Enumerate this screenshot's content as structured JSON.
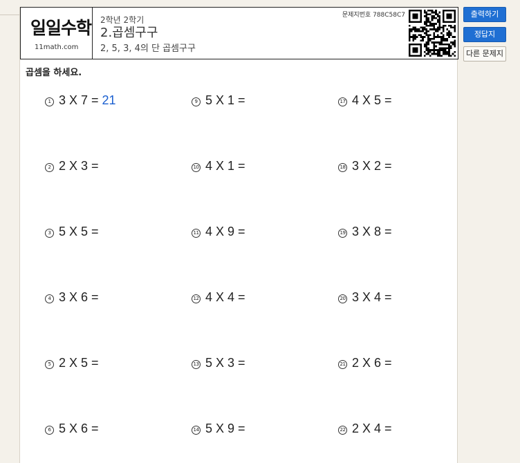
{
  "header": {
    "logo": "일일수학",
    "site": "11math.com",
    "grade": "2학년 2학기",
    "title": "2.곱셈구구",
    "subtitle": "2, 5, 3, 4의 단 곱셈구구",
    "code": "문제지번호 788C58C7"
  },
  "instruction": "곱셈을 하세요.",
  "buttons": {
    "print": "출력하기",
    "answers": "정답지",
    "other": "다른 문제지"
  },
  "colors": {
    "accent": "#1f6fd3",
    "answer": "#1a5fd0"
  },
  "columns": [
    [
      {
        "num": "1",
        "expr": "3 X 7 =",
        "answer": "21"
      },
      {
        "num": "2",
        "expr": "2 X 3 =",
        "answer": ""
      },
      {
        "num": "3",
        "expr": "5 X 5 =",
        "answer": ""
      },
      {
        "num": "4",
        "expr": "3 X 6 =",
        "answer": ""
      },
      {
        "num": "5",
        "expr": "2 X 5 =",
        "answer": ""
      },
      {
        "num": "6",
        "expr": "5 X 6 =",
        "answer": ""
      }
    ],
    [
      {
        "num": "9",
        "expr": "5 X 1 =",
        "answer": ""
      },
      {
        "num": "10",
        "expr": "4 X 1 =",
        "answer": ""
      },
      {
        "num": "11",
        "expr": "4 X 9 =",
        "answer": ""
      },
      {
        "num": "12",
        "expr": "4 X 4 =",
        "answer": ""
      },
      {
        "num": "13",
        "expr": "5 X 3 =",
        "answer": ""
      },
      {
        "num": "14",
        "expr": "5 X 9 =",
        "answer": ""
      }
    ],
    [
      {
        "num": "17",
        "expr": "4 X 5 =",
        "answer": ""
      },
      {
        "num": "18",
        "expr": "3 X 2 =",
        "answer": ""
      },
      {
        "num": "19",
        "expr": "3 X 8 =",
        "answer": ""
      },
      {
        "num": "20",
        "expr": "3 X 4 =",
        "answer": ""
      },
      {
        "num": "21",
        "expr": "2 X 6 =",
        "answer": ""
      },
      {
        "num": "22",
        "expr": "2 X 4 =",
        "answer": ""
      }
    ]
  ]
}
